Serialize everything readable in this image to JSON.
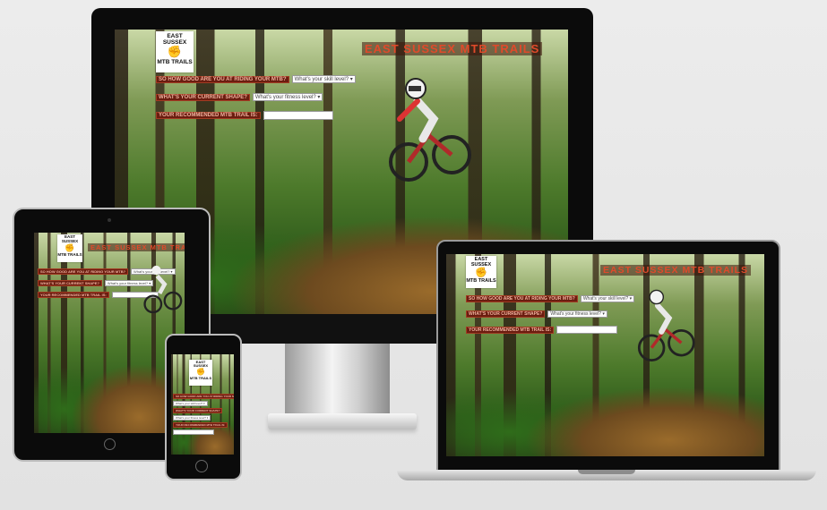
{
  "site": {
    "title": "EAST SUSSEX MTB TRAILS",
    "logo_line1": "EAST SUSSEX",
    "logo_line2": "MTB TRAILS",
    "logo_glyph": "✊"
  },
  "form": {
    "q1": "SO HOW GOOD ARE YOU AT RIDING YOUR MTB?",
    "q1_select": "What's your skill level?",
    "q2": "WHAT'S YOUR CURRENT SHAPE?",
    "q2_select": "What's your fitness level?",
    "q3": "YOUR RECOMMENDED MTB TRAIL IS:",
    "q3_output": ""
  },
  "ui": {
    "dropdown_glyph": "▾"
  },
  "colors": {
    "accent": "#e04a2a",
    "label_bg": "#6b1d10",
    "bezel": "#0b0b0b"
  },
  "icons": [
    "fist-icon",
    "camera-icon",
    "home-button-icon",
    "rider-image"
  ]
}
